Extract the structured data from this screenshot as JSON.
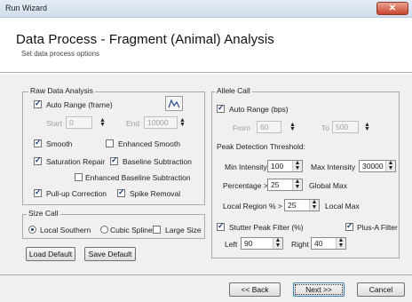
{
  "window": {
    "title": "Run Wizard",
    "close_label": "✕"
  },
  "header": {
    "title": "Data Process - Fragment (Animal) Analysis",
    "subtitle": "Set data process options"
  },
  "raw": {
    "label": "Raw Data Analysis",
    "auto_range": "Auto Range (frame)",
    "start_label": "Start",
    "start_value": "0",
    "end_label": "End",
    "end_value": "10000",
    "smooth": "Smooth",
    "enhanced_smooth": "Enhanced Smooth",
    "saturation_repair": "Saturation Repair",
    "baseline_subtraction": "Baseline Subtraction",
    "enhanced_baseline": "Enhanced Baseline Subtraction",
    "pullup": "Pull-up Correction",
    "spike": "Spike Removal"
  },
  "size_call": {
    "label": "Size Call",
    "local_southern": "Local Southern",
    "cubic_spline": "Cubic Spline",
    "large_size": "Large Size"
  },
  "buttons": {
    "load_default": "Load Default",
    "save_default": "Save Default"
  },
  "allele": {
    "label": "Allele Call",
    "auto_range": "Auto Range (bps)",
    "from_label": "From",
    "from_value": "60",
    "to_label": "To",
    "to_value": "500",
    "peak_title": "Peak Detection Threshold:",
    "min_intensity_label": "Min Intensity",
    "min_intensity_value": "100",
    "max_intensity_label": "Max Intensity",
    "max_intensity_value": "30000",
    "percentage_label": "Percentage >",
    "percentage_value": "25",
    "global_max": "Global Max",
    "local_region_label": "Local Region % >",
    "local_region_value": "25",
    "local_max": "Local Max",
    "stutter": "Stutter Peak Filter (%)",
    "plus_a": "Plus-A Filter",
    "left_label": "Left",
    "left_value": "90",
    "right_label": "Right",
    "right_value": "40"
  },
  "footer": {
    "back": "<< Back",
    "next": "Next >>",
    "cancel": "Cancel"
  }
}
